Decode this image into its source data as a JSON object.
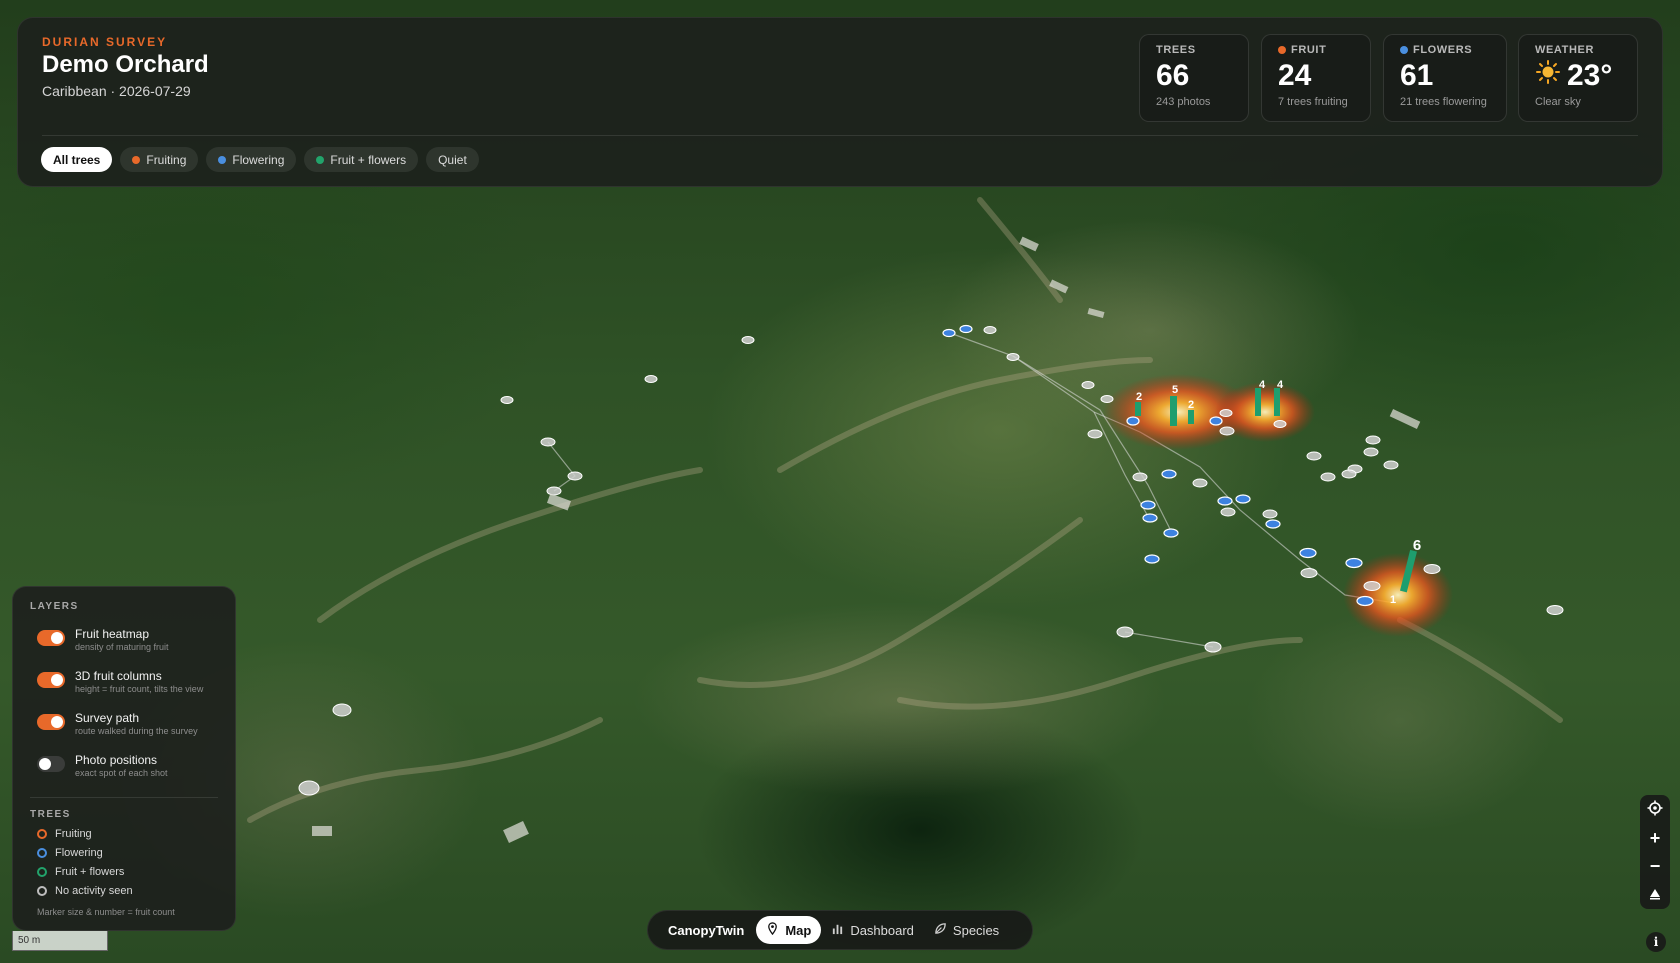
{
  "header": {
    "kicker": "DURIAN SURVEY",
    "title": "Demo Orchard",
    "subtitle": "Caribbean · 2026-07-29"
  },
  "stats": [
    {
      "label": "TREES",
      "value": "66",
      "sub": "243 photos",
      "dot_color": ""
    },
    {
      "label": "FRUIT",
      "value": "24",
      "sub": "7 trees fruiting",
      "dot_color": "#e8692a"
    },
    {
      "label": "FLOWERS",
      "value": "61",
      "sub": "21 trees flowering",
      "dot_color": "#4a8fe0"
    },
    {
      "label": "WEATHER",
      "value": "23°",
      "sub": "Clear sky",
      "icon": "sun-icon"
    }
  ],
  "filters": [
    {
      "label": "All trees",
      "active": true,
      "color": ""
    },
    {
      "label": "Fruiting",
      "active": false,
      "color": "#e8692a"
    },
    {
      "label": "Flowering",
      "active": false,
      "color": "#4a8fe0"
    },
    {
      "label": "Fruit + flowers",
      "active": false,
      "color": "#22a36b"
    },
    {
      "label": "Quiet",
      "active": false,
      "color": ""
    }
  ],
  "layers_panel": {
    "title": "LAYERS",
    "layers": [
      {
        "name": "Fruit heatmap",
        "desc": "density of maturing fruit",
        "on": true
      },
      {
        "name": "3D fruit columns",
        "desc": "height = fruit count, tilts the view",
        "on": true
      },
      {
        "name": "Survey path",
        "desc": "route walked during the survey",
        "on": true
      },
      {
        "name": "Photo positions",
        "desc": "exact spot of each shot",
        "on": false
      }
    ],
    "trees_title": "TREES",
    "legend": [
      {
        "label": "Fruiting",
        "color": "#e8692a"
      },
      {
        "label": "Flowering",
        "color": "#4a8fe0"
      },
      {
        "label": "Fruit + flowers",
        "color": "#22a36b"
      },
      {
        "label": "No activity seen",
        "color": "#bdbdbd"
      }
    ],
    "note": "Marker size & number = fruit count"
  },
  "scale": {
    "label": "50 m"
  },
  "nav": {
    "brand": "CanopyTwin",
    "items": [
      {
        "label": "Map",
        "icon": "map-pin-icon",
        "active": true
      },
      {
        "label": "Dashboard",
        "icon": "bar-chart-icon",
        "active": false
      },
      {
        "label": "Species",
        "icon": "leaf-icon",
        "active": false
      }
    ]
  },
  "map": {
    "fruit_columns": [
      {
        "count": "2"
      },
      {
        "count": "5"
      },
      {
        "count": "2"
      },
      {
        "count": "4"
      },
      {
        "count": "4"
      },
      {
        "count": "6"
      },
      {
        "count": "1"
      }
    ]
  },
  "colors": {
    "accent": "#e8692a",
    "flowering": "#4a8fe0",
    "fruit_flowers": "#22a36b",
    "quiet": "#bdbdbd"
  }
}
